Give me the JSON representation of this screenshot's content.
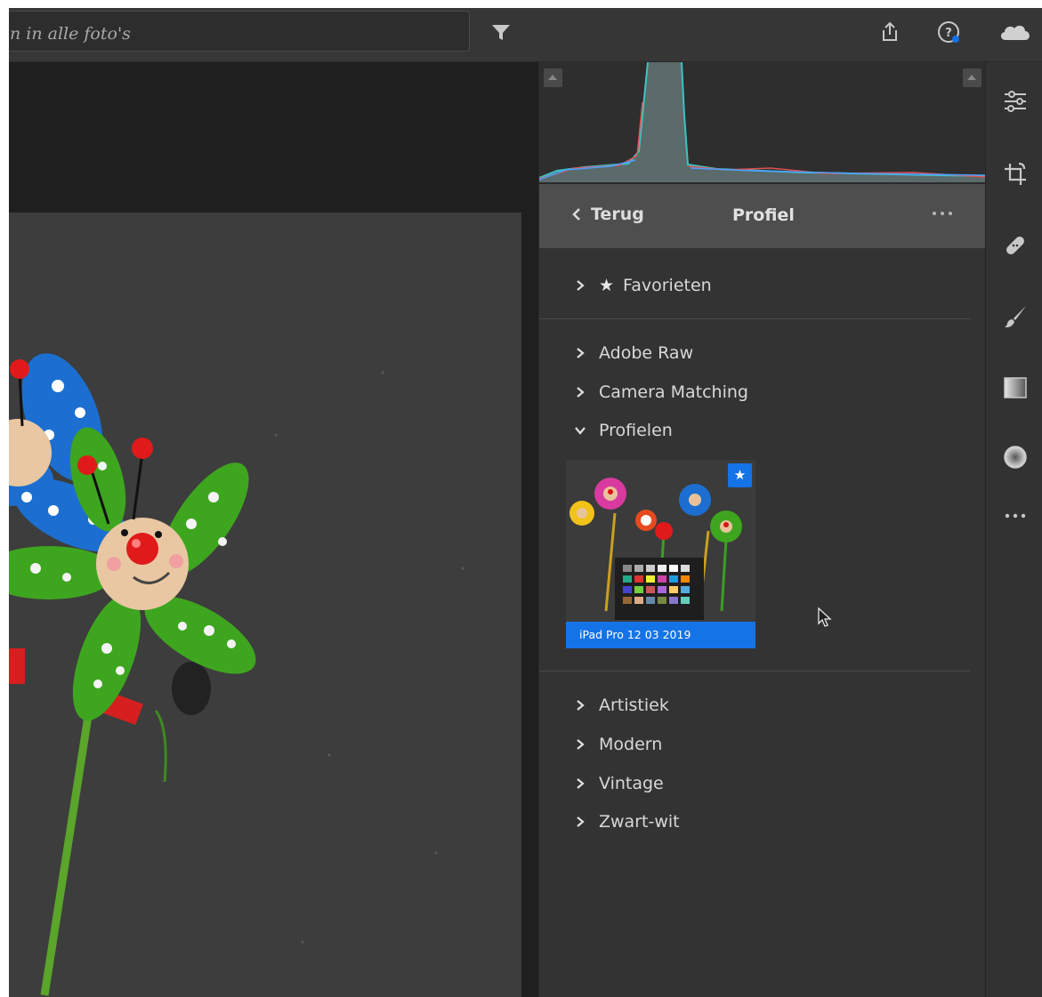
{
  "search": {
    "placeholder": "n in alle foto's"
  },
  "top_icons": [
    "filter-icon",
    "share-icon",
    "help-icon",
    "cloud-icon"
  ],
  "profile_panel": {
    "back_label": "Terug",
    "title": "Profiel",
    "favorites_label": "Favorieten",
    "groups_top": [
      "Adobe Raw",
      "Camera Matching",
      "Profielen"
    ],
    "expanded_group": "Profielen",
    "profile_thumbnail_label": "iPad Pro 12 03 2019",
    "groups_bottom": [
      "Artistiek",
      "Modern",
      "Vintage",
      "Zwart-wit"
    ]
  },
  "tool_strip": [
    "edit-sliders-icon",
    "crop-icon",
    "healing-icon",
    "brush-icon",
    "linear-gradient-icon",
    "radial-gradient-icon",
    "more-icon"
  ],
  "colors": {
    "accent": "#1473e6",
    "panel": "#333333",
    "header": "#4e4e4e"
  }
}
